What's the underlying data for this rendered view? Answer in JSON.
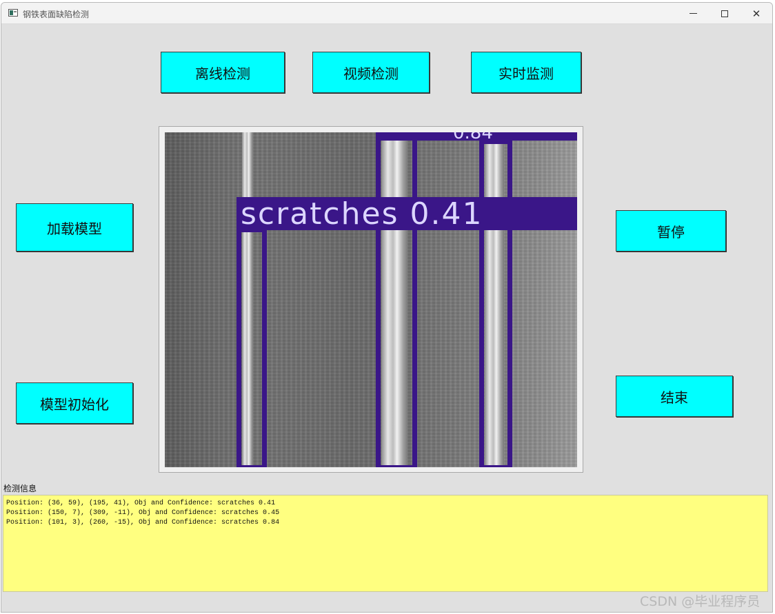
{
  "window": {
    "title": "钢铁表面缺陷检测",
    "controls": {
      "minimize": "",
      "maximize": "",
      "close": "✕"
    }
  },
  "buttons": {
    "offline_detect": "离线检测",
    "video_detect": "视频检测",
    "realtime_monitor": "实时监测",
    "load_model": "加载模型",
    "init_model": "模型初始化",
    "pause": "暂停",
    "stop": "结束"
  },
  "image": {
    "label_text": "scratches 0.41",
    "top_label_fragment": "0.84",
    "box_color": "#3a1688"
  },
  "info": {
    "label": "检测信息",
    "lines": [
      "Position: (36, 59), (195, 41), Obj and Confidence: scratches 0.41",
      "Position: (150, 7), (309, -11), Obj and Confidence: scratches 0.45",
      "Position: (101, 3), (260, -15), Obj and Confidence: scratches 0.84"
    ],
    "background": "#ffff80"
  },
  "watermark": "CSDN @毕业程序员",
  "colors": {
    "button": "#00ffff",
    "window_bg": "#e0e0e0"
  }
}
